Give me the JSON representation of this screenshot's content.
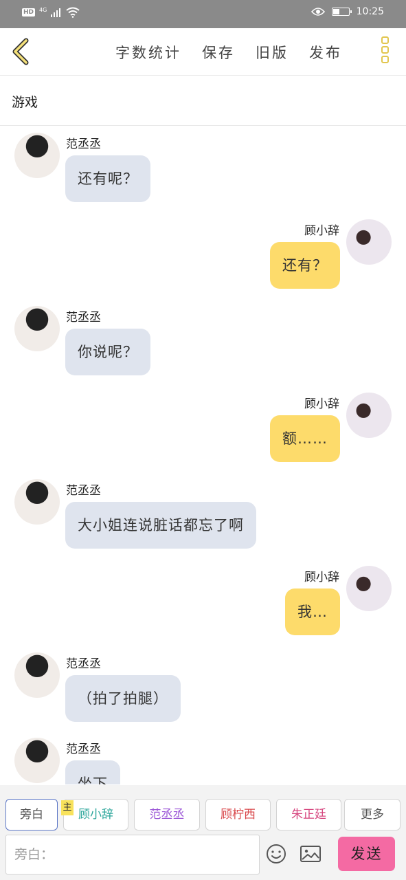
{
  "status_bar": {
    "hd": "HD",
    "network": "4G",
    "time": "10:25",
    "battery_level": 0.45
  },
  "top_bar": {
    "actions": [
      "字数统计",
      "保存",
      "旧版",
      "发布"
    ]
  },
  "story": {
    "title": "游戏"
  },
  "messages": [
    {
      "side": "left",
      "sender": "范丞丞",
      "text": "还有呢？"
    },
    {
      "side": "right",
      "sender": "顾小辞",
      "text": "还有？"
    },
    {
      "side": "left",
      "sender": "范丞丞",
      "text": "你说呢？"
    },
    {
      "side": "right",
      "sender": "顾小辞",
      "text": "额……"
    },
    {
      "side": "left",
      "sender": "范丞丞",
      "text": "大小姐连说脏话都忘了啊"
    },
    {
      "side": "right",
      "sender": "顾小辞",
      "text": "我…"
    },
    {
      "side": "left",
      "sender": "范丞丞",
      "text": "（拍了拍腿）"
    },
    {
      "side": "left",
      "sender": "范丞丞",
      "text": "坐下"
    }
  ],
  "roles": {
    "main_badge": "主",
    "items": [
      {
        "label": "旁白",
        "color": "#555555"
      },
      {
        "label": "顾小辞",
        "color": "#2aa59a"
      },
      {
        "label": "范丞丞",
        "color": "#9a55d6"
      },
      {
        "label": "顾柠西",
        "color": "#d8474a"
      },
      {
        "label": "朱正廷",
        "color": "#d6457e"
      },
      {
        "label": "更多",
        "color": "#555555"
      }
    ]
  },
  "input": {
    "placeholder": "旁白：",
    "send_label": "发送"
  },
  "colors": {
    "accent_yellow": "#fddb6b",
    "bubble_gray": "#dfe4ee",
    "send_pink": "#f46aa3"
  }
}
